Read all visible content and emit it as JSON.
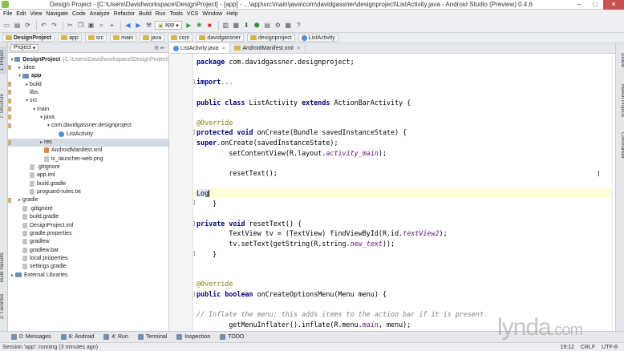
{
  "window": {
    "title": "Design Project - [C:\\Users\\David\\workspace\\DesignProject] - [app] - ...\\app\\src\\main\\java\\com\\davidgassner\\designproject\\ListActivity.java - Android Studio (Preview) 0.4.6",
    "minimize": "–",
    "maximize": "□",
    "close": "✕"
  },
  "menu": [
    "File",
    "Edit",
    "View",
    "Navigate",
    "Code",
    "Analyze",
    "Refactor",
    "Build",
    "Run",
    "Tools",
    "VCS",
    "Window",
    "Help"
  ],
  "toolbar": {
    "run_config": "app"
  },
  "breadcrumbs": [
    "DesignProject",
    "app",
    "src",
    "main",
    "java",
    "com",
    "davidgassner",
    "designproject",
    "ListActivity"
  ],
  "left_tabs": {
    "project": "1: Project",
    "structure": "7: Structure",
    "build_variants": "Build Variants",
    "favorites": "2: Favorites"
  },
  "right_tabs": {
    "gradle": "Gradle",
    "maven": "Maven Projects",
    "commander": "Commander"
  },
  "project_panel": {
    "selector": "Project",
    "tree": [
      {
        "label": "DesignProject",
        "path": "(C:\\Users\\David\\workspace\\DesignProject)",
        "depth": 0,
        "icon": "mod",
        "arrow": "▾",
        "bold": true
      },
      {
        "label": ".idea",
        "depth": 1,
        "icon": "fold",
        "arrow": "▸"
      },
      {
        "label": "app",
        "depth": 1,
        "icon": "mod",
        "arrow": "▾",
        "bold": true
      },
      {
        "label": "build",
        "depth": 2,
        "icon": "fold",
        "arrow": "▸"
      },
      {
        "label": "libs",
        "depth": 2,
        "icon": "fold",
        "arrow": ""
      },
      {
        "label": "src",
        "depth": 2,
        "icon": "fold",
        "arrow": "▾"
      },
      {
        "label": "main",
        "depth": 3,
        "icon": "fold",
        "arrow": "▾"
      },
      {
        "label": "java",
        "depth": 4,
        "icon": "fold",
        "arrow": "▾"
      },
      {
        "label": "com.davidgassner.designproject",
        "depth": 5,
        "icon": "fold",
        "arrow": "▾"
      },
      {
        "label": "ListActivity",
        "depth": 6,
        "icon": "java",
        "arrow": ""
      },
      {
        "label": "res",
        "depth": 4,
        "icon": "fold",
        "arrow": "▸",
        "selected": true
      },
      {
        "label": "AndroidManifest.xml",
        "depth": 4,
        "icon": "xml",
        "arrow": ""
      },
      {
        "label": "ic_launcher-web.png",
        "depth": 4,
        "icon": "file",
        "arrow": ""
      },
      {
        "label": ".gitignore",
        "depth": 2,
        "icon": "file",
        "arrow": ""
      },
      {
        "label": "app.iml",
        "depth": 2,
        "icon": "file",
        "arrow": ""
      },
      {
        "label": "build.gradle",
        "depth": 2,
        "icon": "file",
        "arrow": ""
      },
      {
        "label": "proguard-rules.txt",
        "depth": 2,
        "icon": "file",
        "arrow": ""
      },
      {
        "label": "gradle",
        "depth": 1,
        "icon": "fold",
        "arrow": "▸"
      },
      {
        "label": ".gitignore",
        "depth": 1,
        "icon": "file",
        "arrow": ""
      },
      {
        "label": "build.gradle",
        "depth": 1,
        "icon": "file",
        "arrow": ""
      },
      {
        "label": "DesignProject.iml",
        "depth": 1,
        "icon": "file",
        "arrow": ""
      },
      {
        "label": "gradle.properties",
        "depth": 1,
        "icon": "file",
        "arrow": ""
      },
      {
        "label": "gradlew",
        "depth": 1,
        "icon": "file",
        "arrow": ""
      },
      {
        "label": "gradlew.bat",
        "depth": 1,
        "icon": "file",
        "arrow": ""
      },
      {
        "label": "local.properties",
        "depth": 1,
        "icon": "file",
        "arrow": ""
      },
      {
        "label": "settings.gradle",
        "depth": 1,
        "icon": "file",
        "arrow": ""
      },
      {
        "label": "External Libraries",
        "depth": 0,
        "icon": "mod",
        "arrow": "▸"
      }
    ]
  },
  "editor": {
    "tabs": [
      {
        "label": "ListActivity.java",
        "active": true
      },
      {
        "label": "AndroidManifest.xml",
        "active": false
      }
    ],
    "lines": [
      {
        "n": "1",
        "html": "<span class=\"kw\">package</span> com.davidgassner.designproject;"
      },
      {
        "n": "2",
        "html": ""
      },
      {
        "n": "3",
        "html": "<span class=\"kw\">import</span> <span class=\"str\">...</span>",
        "fold": "+"
      },
      {
        "n": "9",
        "html": ""
      },
      {
        "n": "10",
        "html": "<span class=\"kw\">public class</span> ListActivity <span class=\"kw\">extends</span> ActionBarActivity {",
        "mark": "#d97a2b"
      },
      {
        "n": "11",
        "html": ""
      },
      {
        "n": "12",
        "html": "    <span class=\"ann\">@Override</span>"
      },
      {
        "n": "13",
        "html": "    <span class=\"kw\">protected void</span> onCreate(Bundle savedInstanceState) {",
        "mark": "#4a90d9",
        "fold": "-"
      },
      {
        "n": "14",
        "html": "        <span class=\"kw\">super</span>.onCreate(savedInstanceState);"
      },
      {
        "n": "15",
        "html": "        setContentView(R.layout.<span class=\"it\">activity_main</span>);"
      },
      {
        "n": "16",
        "html": ""
      },
      {
        "n": "17",
        "html": "        resetText();"
      },
      {
        "n": "18",
        "html": ""
      },
      {
        "n": "19",
        "html": "        <span class=\"logtxt\">Log</span><span class=\"caret\"></span>",
        "current": true
      },
      {
        "n": "20",
        "html": "    }",
        "fold": "-"
      },
      {
        "n": "21",
        "html": ""
      },
      {
        "n": "22",
        "html": "    <span class=\"kw\">private void</span> resetText() {",
        "fold": "-"
      },
      {
        "n": "23",
        "html": "        TextView tv = (TextView) findViewById(R.id.<span class=\"it\">textView2</span>);"
      },
      {
        "n": "24",
        "html": "        tv.setText(getString(R.string.<span class=\"it\">new_text</span>));"
      },
      {
        "n": "25",
        "html": "    }",
        "fold": "-"
      },
      {
        "n": "26",
        "html": ""
      },
      {
        "n": "27",
        "html": ""
      },
      {
        "n": "28",
        "html": "    <span class=\"ann\">@Override</span>"
      },
      {
        "n": "29",
        "html": "    <span class=\"kw\">public boolean</span> onCreateOptionsMenu(Menu menu) {",
        "mark": "#4a90d9",
        "fold": "-"
      },
      {
        "n": "30",
        "html": ""
      },
      {
        "n": "31",
        "html": "        <span class=\"cmt\">// Inflate the menu; this adds items to the action bar if it is present.</span>"
      },
      {
        "n": "32",
        "html": "        getMenuInflater().inflate(R.menu.<span class=\"it\">main</span>, menu);"
      },
      {
        "n": "33",
        "html": "        <span class=\"kw\">return true</span>;"
      }
    ]
  },
  "bottom_tools": [
    {
      "label": "0: Messages"
    },
    {
      "label": "6: Android"
    },
    {
      "label": "4: Run"
    },
    {
      "label": "Terminal"
    },
    {
      "label": "Inspection"
    },
    {
      "label": "TODO"
    }
  ],
  "status": {
    "message": "Session 'app': running (3 minutes ago)",
    "position": "19:12",
    "line_sep": "CRLF",
    "encoding": "UTF-8"
  },
  "watermark": {
    "brand": "lynda",
    "suffix": ".com"
  }
}
